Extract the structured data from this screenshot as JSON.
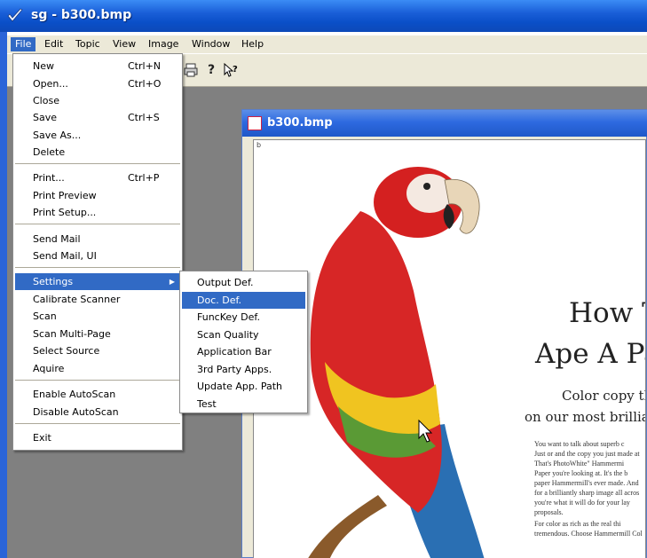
{
  "window": {
    "title": "sg - b300.bmp"
  },
  "menubar": [
    "File",
    "Edit",
    "Topic",
    "View",
    "Image",
    "Window",
    "Help"
  ],
  "file_menu": [
    {
      "label": "New",
      "shortcut": "Ctrl+N"
    },
    {
      "label": "Open...",
      "shortcut": "Ctrl+O"
    },
    {
      "label": "Close",
      "shortcut": ""
    },
    {
      "label": "Save",
      "shortcut": "Ctrl+S"
    },
    {
      "label": "Save As...",
      "shortcut": ""
    },
    {
      "label": "Delete",
      "shortcut": ""
    },
    {
      "label": "Print...",
      "shortcut": "Ctrl+P"
    },
    {
      "label": "Print Preview",
      "shortcut": ""
    },
    {
      "label": "Print Setup...",
      "shortcut": ""
    },
    {
      "label": "Send Mail",
      "shortcut": ""
    },
    {
      "label": "Send Mail, UI",
      "shortcut": ""
    },
    {
      "label": "Settings",
      "shortcut": ""
    },
    {
      "label": "Calibrate Scanner",
      "shortcut": ""
    },
    {
      "label": "Scan",
      "shortcut": ""
    },
    {
      "label": "Scan Multi-Page",
      "shortcut": ""
    },
    {
      "label": "Select Source",
      "shortcut": ""
    },
    {
      "label": "Aquire",
      "shortcut": ""
    },
    {
      "label": "Enable AutoScan",
      "shortcut": ""
    },
    {
      "label": "Disable AutoScan",
      "shortcut": ""
    },
    {
      "label": "Exit",
      "shortcut": ""
    }
  ],
  "settings_menu": [
    "Output Def.",
    "Doc. Def.",
    "FuncKey Def.",
    "Scan Quality",
    "Application Bar",
    "3rd Party Apps.",
    "Update App. Path",
    "Test"
  ],
  "child_window": {
    "title": "b300.bmp",
    "corner_mark": "b",
    "ad": {
      "headline1": "How To",
      "headline2": "Ape A Par",
      "sub1": "Color copy this",
      "sub2": "on our most brilliant pa",
      "body": [
        "You want to talk about superb c",
        "Just or and the copy you just made at",
        "That's PhotoWhite\" Hammermi",
        "Paper you're looking at. It's the b",
        "paper Hammermill's ever made. And",
        "for a brilliantly sharp image all acros",
        "you're what it will do for your lay",
        "proposals.",
        "For color as rich as the real thi",
        "tremendous. Choose Hammermill Col"
      ]
    }
  },
  "colors": {
    "highlight": "#316ac5",
    "menu_bg": "#ece9d8",
    "workspace": "#808080",
    "titlebar": "#0a4fc8"
  }
}
